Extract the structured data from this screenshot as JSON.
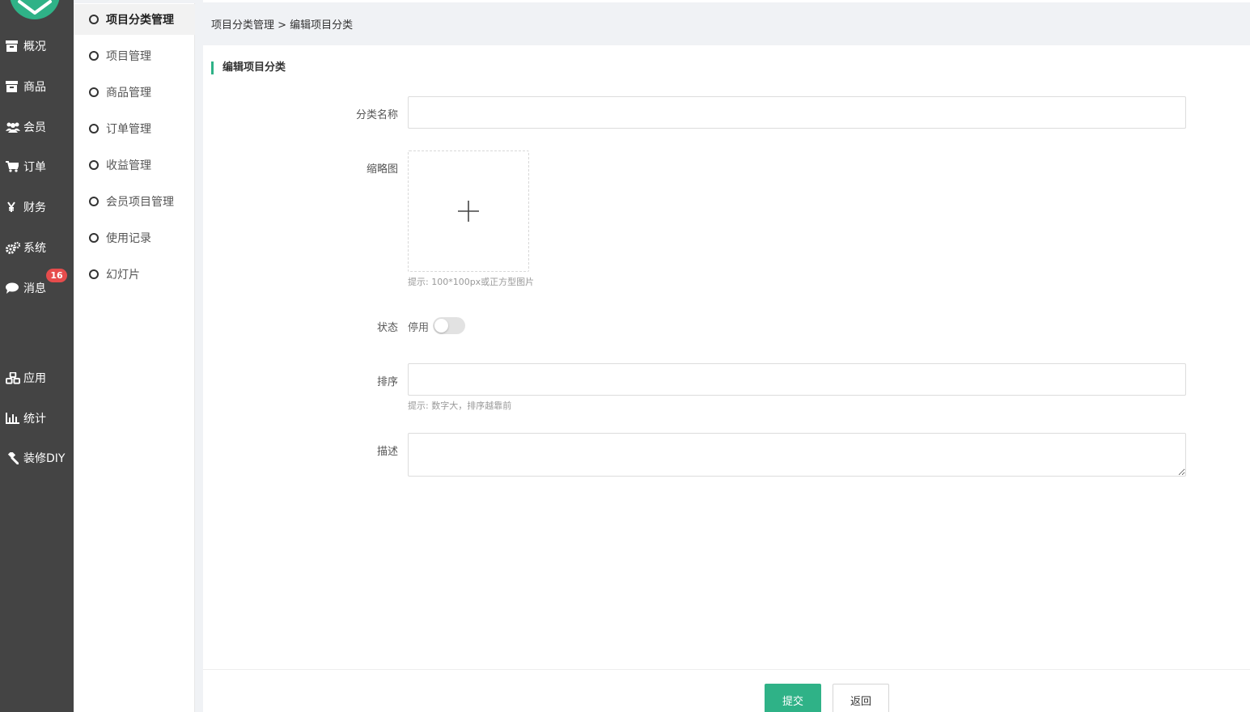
{
  "nav": {
    "items": [
      {
        "label": "概况",
        "icon": "archive-icon"
      },
      {
        "label": "商品",
        "icon": "archive-icon"
      },
      {
        "label": "会员",
        "icon": "users-icon"
      },
      {
        "label": "订单",
        "icon": "cart-icon"
      },
      {
        "label": "财务",
        "icon": "yen-icon"
      },
      {
        "label": "系统",
        "icon": "gears-icon"
      },
      {
        "label": "消息",
        "icon": "comment-icon"
      },
      {
        "label": "应用",
        "icon": "cubes-icon"
      },
      {
        "label": "统计",
        "icon": "bar-chart-icon"
      },
      {
        "label": "装修DIY",
        "icon": "gavel-icon"
      }
    ],
    "message_badge": "16"
  },
  "subnav": {
    "items": [
      {
        "label": "项目分类管理",
        "active": true
      },
      {
        "label": "项目管理"
      },
      {
        "label": "商品管理"
      },
      {
        "label": "订单管理"
      },
      {
        "label": "收益管理"
      },
      {
        "label": "会员项目管理"
      },
      {
        "label": "使用记录"
      },
      {
        "label": "幻灯片"
      }
    ]
  },
  "breadcrumb": "项目分类管理 > 编辑项目分类",
  "form": {
    "title": "编辑项目分类",
    "name_label": "分类名称",
    "name_value": "",
    "thumb_label": "缩略图",
    "thumb_hint": "提示: 100*100px或正方型图片",
    "status_label": "状态",
    "status_value": "停用",
    "sort_label": "排序",
    "sort_value": "",
    "sort_hint": "提示: 数字大，排序越靠前",
    "desc_label": "描述",
    "desc_value": ""
  },
  "buttons": {
    "submit": "提交",
    "back": "返回"
  },
  "colors": {
    "accent": "#2fb287",
    "sidebar": "#444444",
    "badge": "#e64c4c"
  }
}
